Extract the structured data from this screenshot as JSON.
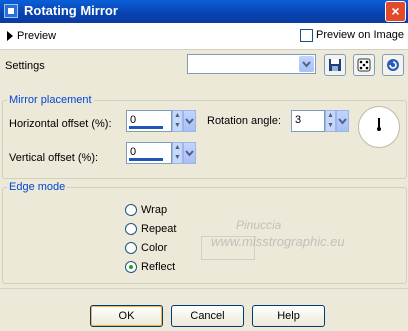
{
  "window": {
    "title": "Rotating Mirror",
    "close_glyph": "×"
  },
  "preview": {
    "label": "Preview",
    "preview_on_image_label": "Preview on Image",
    "preview_on_image_checked": false
  },
  "settings": {
    "label": "Settings",
    "preset_value": ""
  },
  "mirror_placement": {
    "legend": "Mirror placement",
    "horizontal_offset_label": "Horizontal offset (%):",
    "horizontal_offset_value": "0",
    "vertical_offset_label": "Vertical offset (%):",
    "vertical_offset_value": "0",
    "rotation_angle_label": "Rotation angle:",
    "rotation_angle_value": "3"
  },
  "edge_mode": {
    "legend": "Edge mode",
    "options": [
      "Wrap",
      "Repeat",
      "Color",
      "Reflect"
    ],
    "selected": "Reflect"
  },
  "watermark": {
    "line1": "Pinuccia",
    "line2": "www.misstrographic.eu"
  },
  "buttons": {
    "ok": "OK",
    "cancel": "Cancel",
    "help": "Help"
  },
  "colors": {
    "title_bar": "#0842b0",
    "dialog_bg": "#ece9d8",
    "legend_text": "#0046d5"
  }
}
